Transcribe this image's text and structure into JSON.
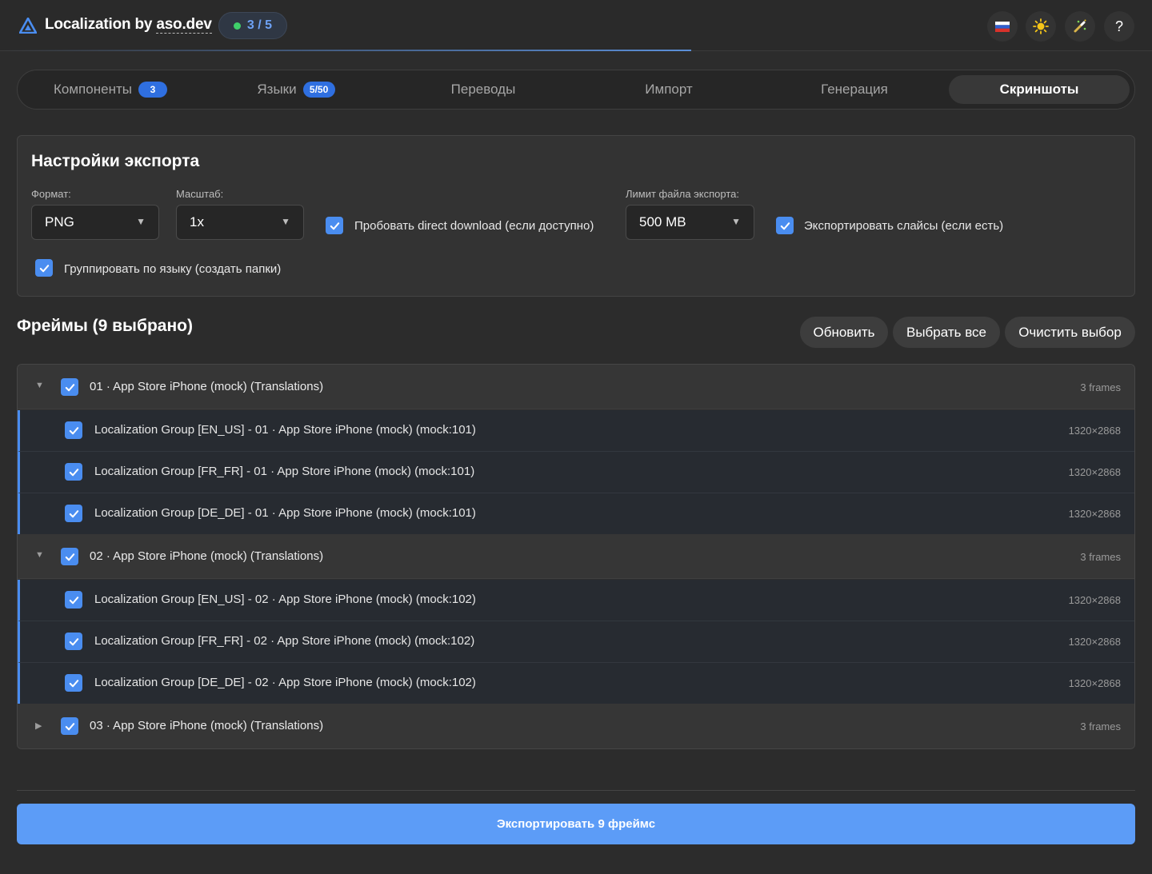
{
  "header": {
    "title_prefix": "Localization by ",
    "title_brand": "aso.dev",
    "step": "3 / 5",
    "icons": {
      "flag": "russia-flag-icon",
      "theme": "sun-icon",
      "tool": "magic-wand-icon",
      "help": "?"
    },
    "colors": {
      "accent": "#4a8df0",
      "status_dot": "#3fcf6a"
    }
  },
  "tabs": [
    {
      "label": "Компоненты",
      "badge": "3"
    },
    {
      "label": "Языки",
      "badge": "5/50"
    },
    {
      "label": "Переводы",
      "badge": ""
    },
    {
      "label": "Импорт",
      "badge": ""
    },
    {
      "label": "Генерация",
      "badge": ""
    },
    {
      "label": "Скриншоты",
      "badge": "",
      "active": true
    }
  ],
  "settings": {
    "title": "Настройки экспорта",
    "format": {
      "label": "Формат:",
      "value": "PNG"
    },
    "scale": {
      "label": "Масштаб:",
      "value": "1x"
    },
    "direct_download": {
      "label": "Пробовать direct download (если доступно)",
      "checked": true
    },
    "limit": {
      "label": "Лимит файла экспорта:",
      "value": "500 MB"
    },
    "export_slices": {
      "label": "Экспортировать слайсы (если есть)",
      "checked": true
    },
    "group_by_lang": {
      "label": "Группировать по языку (создать папки)",
      "checked": true
    }
  },
  "frames_header": {
    "title": "Фреймы (9 выбрано)",
    "refresh": "Обновить",
    "select_all": "Выбрать все",
    "clear": "Очистить выбор"
  },
  "groups": [
    {
      "label": "01 · App Store iPhone (mock) (Translations)",
      "count": "3 frames",
      "expanded": true,
      "frames": [
        {
          "label": "Localization Group [EN_US] - 01 · App Store iPhone (mock) (mock:101)",
          "size": "1320×2868"
        },
        {
          "label": "Localization Group [FR_FR] - 01 · App Store iPhone (mock) (mock:101)",
          "size": "1320×2868"
        },
        {
          "label": "Localization Group [DE_DE] - 01 · App Store iPhone (mock) (mock:101)",
          "size": "1320×2868"
        }
      ]
    },
    {
      "label": "02 · App Store iPhone (mock) (Translations)",
      "count": "3 frames",
      "expanded": true,
      "frames": [
        {
          "label": "Localization Group [EN_US] - 02 · App Store iPhone (mock) (mock:102)",
          "size": "1320×2868"
        },
        {
          "label": "Localization Group [FR_FR] - 02 · App Store iPhone (mock) (mock:102)",
          "size": "1320×2868"
        },
        {
          "label": "Localization Group [DE_DE] - 02 · App Store iPhone (mock) (mock:102)",
          "size": "1320×2868"
        }
      ]
    },
    {
      "label": "03 · App Store iPhone (mock) (Translations)",
      "count": "3 frames",
      "expanded": false,
      "frames": []
    }
  ],
  "footer": {
    "export_label": "Экспортировать 9 фреймс"
  }
}
